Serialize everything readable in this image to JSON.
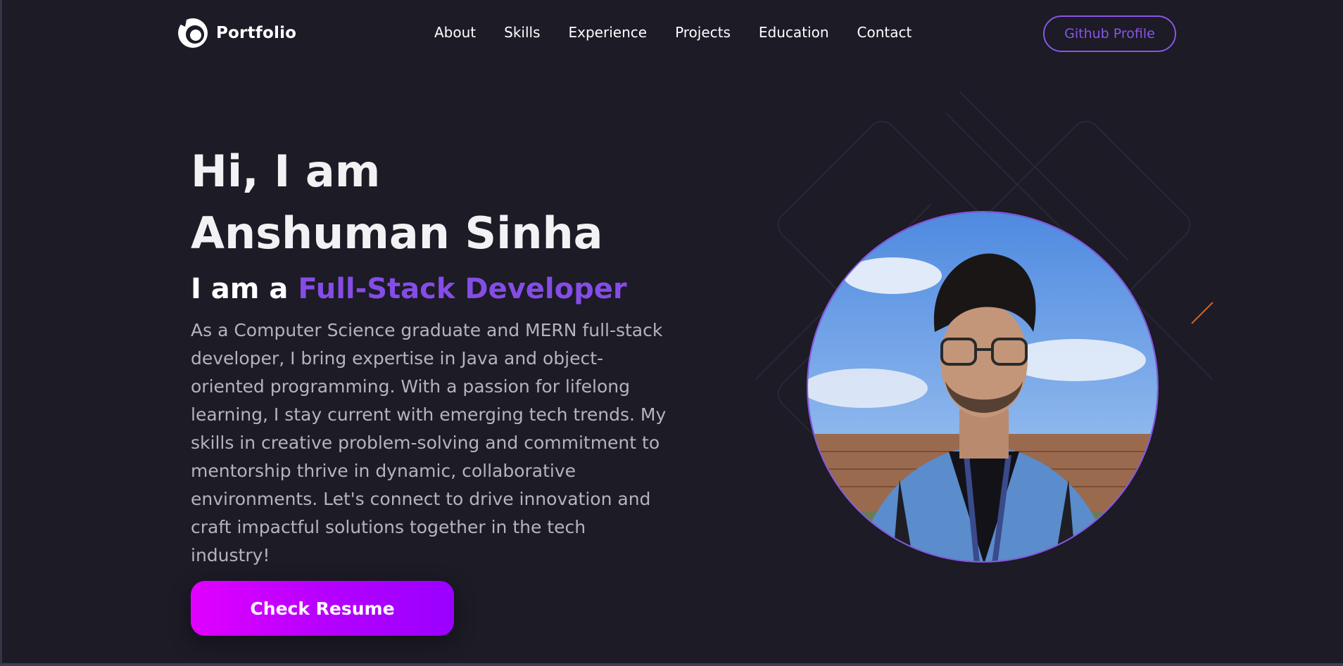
{
  "nav": {
    "logo_text": "Portfolio",
    "links": [
      "About",
      "Skills",
      "Experience",
      "Projects",
      "Education",
      "Contact"
    ],
    "github_label": "Github Profile"
  },
  "hero": {
    "greeting": "Hi, I am",
    "name": "Anshuman Sinha",
    "role_prefix": "I am a",
    "role": "Full-Stack Developer",
    "description": "As a Computer Science graduate and MERN full-stack developer, I bring expertise in Java and object-oriented programming. With a passion for lifelong learning, I stay current with emerging tech trends. My skills in creative problem-solving and commitment to mentorship thrive in dynamic, collaborative environments. Let's connect to drive innovation and craft impactful solutions together in the tech industry!",
    "resume_label": "Check Resume"
  },
  "colors": {
    "background": "#1c1b26",
    "accent": "#854ce6",
    "button_gradient_start": "#e100ff",
    "button_gradient_end": "#9a00ff"
  },
  "icons": {
    "logo": "portfolio-logo-icon"
  }
}
